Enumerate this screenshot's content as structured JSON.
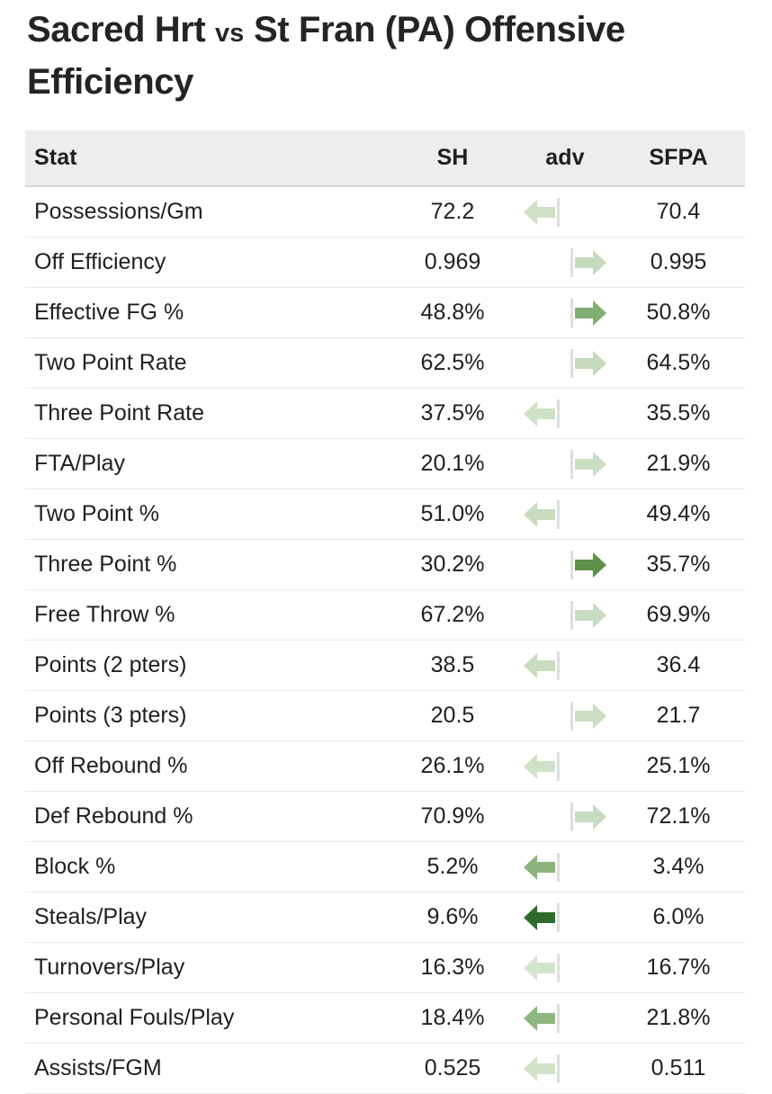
{
  "title": {
    "part1": "Sacred Hrt",
    "vs": "vs",
    "part2": "St Fran (PA) Offensive Efficiency"
  },
  "table": {
    "headers": {
      "stat": "Stat",
      "home": "SH",
      "adv": "adv",
      "away": "SFPA"
    },
    "rows": [
      {
        "stat": "Possessions/Gm",
        "home": "72.2",
        "adv_dir": "left",
        "adv_color": "#cfe0c8",
        "away": "70.4"
      },
      {
        "stat": "Off Efficiency",
        "home": "0.969",
        "adv_dir": "right",
        "adv_color": "#c6dbbd",
        "away": "0.995"
      },
      {
        "stat": "Effective FG %",
        "home": "48.8%",
        "adv_dir": "right",
        "adv_color": "#82ae73",
        "away": "50.8%"
      },
      {
        "stat": "Two Point Rate",
        "home": "62.5%",
        "adv_dir": "right",
        "adv_color": "#c4dabb",
        "away": "64.5%"
      },
      {
        "stat": "Three Point Rate",
        "home": "37.5%",
        "adv_dir": "left",
        "adv_color": "#cfe2c8",
        "away": "35.5%"
      },
      {
        "stat": "FTA/Play",
        "home": "20.1%",
        "adv_dir": "right",
        "adv_color": "#cbdec3",
        "away": "21.9%"
      },
      {
        "stat": "Two Point %",
        "home": "51.0%",
        "adv_dir": "left",
        "adv_color": "#c8dcc0",
        "away": "49.4%"
      },
      {
        "stat": "Three Point %",
        "home": "30.2%",
        "adv_dir": "right",
        "adv_color": "#5d9149",
        "away": "35.7%"
      },
      {
        "stat": "Free Throw %",
        "home": "67.2%",
        "adv_dir": "right",
        "adv_color": "#c9dcc1",
        "away": "69.9%"
      },
      {
        "stat": "Points (2 pters)",
        "home": "38.5",
        "adv_dir": "left",
        "adv_color": "#c8dcc0",
        "away": "36.4"
      },
      {
        "stat": "Points (3 pters)",
        "home": "20.5",
        "adv_dir": "right",
        "adv_color": "#cadec2",
        "away": "21.7"
      },
      {
        "stat": "Off Rebound %",
        "home": "26.1%",
        "adv_dir": "left",
        "adv_color": "#cfe2c8",
        "away": "25.1%"
      },
      {
        "stat": "Def Rebound %",
        "home": "70.9%",
        "adv_dir": "right",
        "adv_color": "#c8dcc0",
        "away": "72.1%"
      },
      {
        "stat": "Block %",
        "home": "5.2%",
        "adv_dir": "left",
        "adv_color": "#8cb47c",
        "away": "3.4%"
      },
      {
        "stat": "Steals/Play",
        "home": "9.6%",
        "adv_dir": "left",
        "adv_color": "#2f6b2b",
        "away": "6.0%"
      },
      {
        "stat": "Turnovers/Play",
        "home": "16.3%",
        "adv_dir": "left",
        "adv_color": "#d3e4cc",
        "away": "16.7%"
      },
      {
        "stat": "Personal Fouls/Play",
        "home": "18.4%",
        "adv_dir": "left",
        "adv_color": "#8fb880",
        "away": "21.8%"
      },
      {
        "stat": "Assists/FGM",
        "home": "0.525",
        "adv_dir": "left",
        "adv_color": "#d1e3ca",
        "away": "0.511"
      }
    ]
  }
}
